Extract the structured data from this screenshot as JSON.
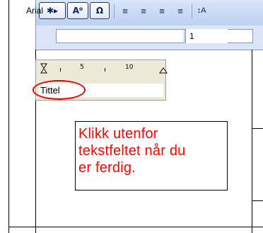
{
  "toolbar": {
    "buttons": [
      {
        "name": "special-char-button",
        "glyph": "✱▸"
      },
      {
        "name": "field-button",
        "glyph": "A⁰"
      },
      {
        "name": "symbol-button",
        "glyph": "Ω"
      }
    ],
    "align_icons": [
      "≡",
      "≡",
      "≡",
      "≡"
    ],
    "spacing_icon": "↕A"
  },
  "font": {
    "name": "Arial",
    "size": "1"
  },
  "text_frame": {
    "ruler_numbers": [
      "5",
      "10"
    ],
    "value": "Tittel"
  },
  "callout": {
    "text": "Klikk utenfor\ntekstfeltet når du\ner ferdig."
  },
  "colors": {
    "callout_text": "#ff0000",
    "highlight": "#e00000"
  }
}
